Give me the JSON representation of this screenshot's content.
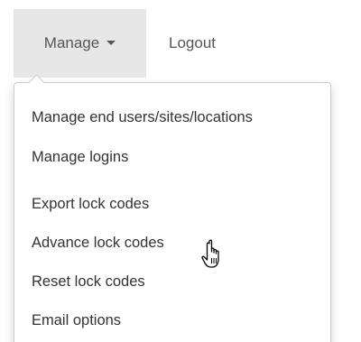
{
  "navbar": {
    "manage_label": "Manage",
    "logout_label": "Logout"
  },
  "dropdown": {
    "items": [
      {
        "label": "Manage end users/sites/locations"
      },
      {
        "label": "Manage logins"
      },
      {
        "label": "Export lock codes"
      },
      {
        "label": "Advance lock codes"
      },
      {
        "label": "Reset lock codes"
      },
      {
        "label": "Email options"
      }
    ]
  },
  "colors": {
    "active_tab_bg": "#e7e7e7",
    "text": "#333333",
    "nav_text": "#555555",
    "border": "#cccccc"
  },
  "icons": {
    "manage_caret": "caret-down-icon",
    "pointer": "hand-pointer-cursor-icon"
  }
}
